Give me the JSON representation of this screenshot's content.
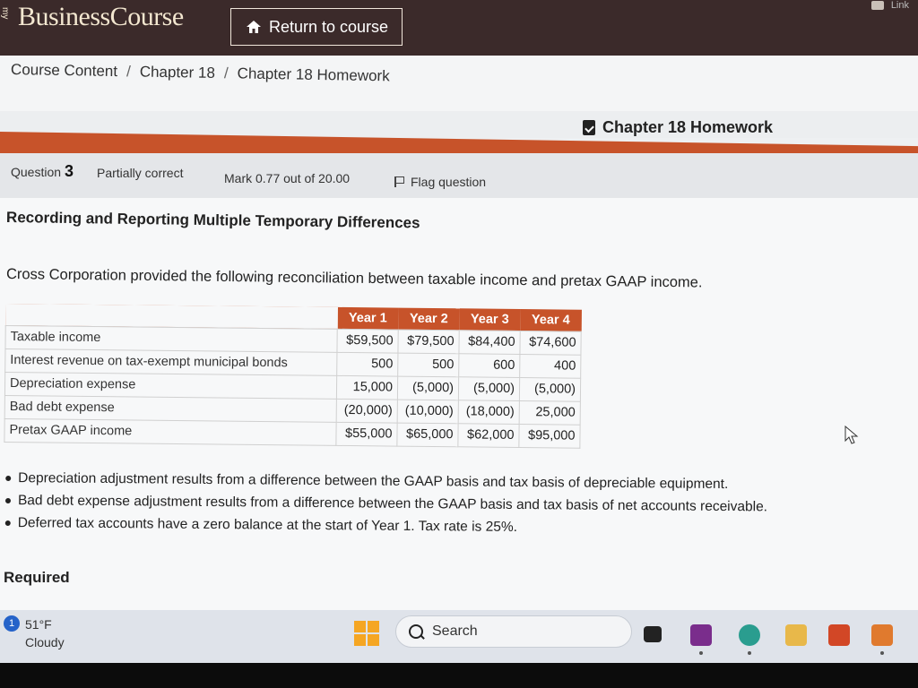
{
  "header": {
    "brand_side": "my",
    "brand": "BusinessCourse",
    "return_label": "Return to course",
    "top_right_text": "Link"
  },
  "breadcrumb": [
    "Course Content",
    "Chapter 18",
    "Chapter 18 Homework"
  ],
  "assignment_title": "Chapter 18 Homework",
  "question": {
    "label": "Question",
    "number": "3",
    "status": "Partially correct",
    "mark": "Mark 0.77 out of 20.00",
    "flag": "Flag question",
    "title": "Recording and Reporting Multiple Temporary Differences",
    "intro": "Cross Corporation provided the following reconciliation between taxable income and pretax GAAP income."
  },
  "table": {
    "headers": [
      "Year 1",
      "Year 2",
      "Year 3",
      "Year 4"
    ],
    "rows": [
      {
        "label": "Taxable income",
        "values": [
          "$59,500",
          "$79,500",
          "$84,400",
          "$74,600"
        ]
      },
      {
        "label": "Interest revenue on tax-exempt municipal bonds",
        "values": [
          "500",
          "500",
          "600",
          "400"
        ]
      },
      {
        "label": "Depreciation expense",
        "values": [
          "15,000",
          "(5,000)",
          "(5,000)",
          "(5,000)"
        ]
      },
      {
        "label": "Bad debt expense",
        "values": [
          "(20,000)",
          "(10,000)",
          "(18,000)",
          "25,000"
        ]
      },
      {
        "label": "Pretax GAAP income",
        "values": [
          "$55,000",
          "$65,000",
          "$62,000",
          "$95,000"
        ]
      }
    ]
  },
  "bullets": [
    "Depreciation adjustment results from a difference between the GAAP basis and tax basis of depreciable equipment.",
    "Bad debt expense adjustment results from a difference between the GAAP basis and tax basis of net accounts receivable.",
    "Deferred tax accounts have a zero balance at the start of Year 1. Tax rate is 25%."
  ],
  "required_label": "Required",
  "taskbar": {
    "notification_count": "1",
    "temperature": "51°F",
    "weather": "Cloudy",
    "search_label": "Search",
    "apps": [
      "task-view-icon",
      "onenote-icon",
      "edge-icon",
      "file-explorer-icon",
      "office-icon",
      "outlook-icon"
    ]
  },
  "colors": {
    "accent": "#c7532a",
    "header_bg": "#3b2a2a",
    "windows": "#f5a623"
  }
}
